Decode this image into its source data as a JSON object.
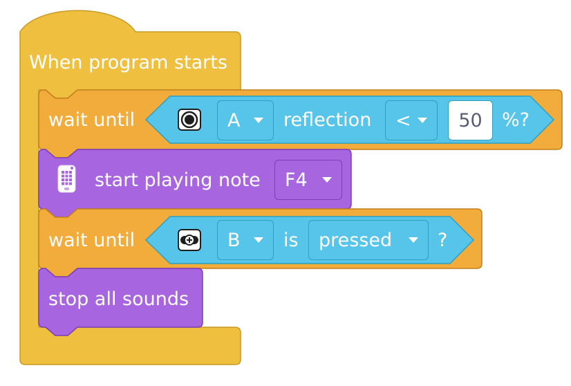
{
  "hat_block": {
    "label": "When program starts",
    "color": "#efbf3f"
  },
  "blocks": [
    {
      "label": "wait until",
      "color": "#f2ac3c",
      "condition": {
        "sensor_icon": "color-sensor-icon",
        "port": "A",
        "text": "reflection",
        "operator": "<",
        "value": "50",
        "suffix": "%?"
      }
    },
    {
      "icon": "sound-brick-icon",
      "label": "start playing note",
      "note": "F4",
      "color": "#a865e0"
    },
    {
      "label": "wait until",
      "color": "#f2ac3c",
      "condition": {
        "sensor_icon": "touch-sensor-icon",
        "port": "B",
        "text": "is",
        "state": "pressed",
        "suffix": "?"
      }
    },
    {
      "label": "stop all sounds",
      "color": "#a865e0"
    }
  ],
  "colors": {
    "sensor_blue": "#57c4ea",
    "sound_purple": "#a865e0",
    "control_orange": "#f2ac3c",
    "event_yellow": "#efbf3f"
  }
}
